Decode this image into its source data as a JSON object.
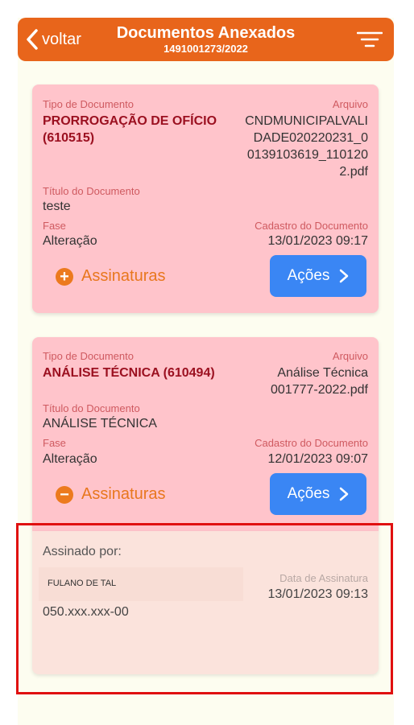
{
  "header": {
    "back_label": "voltar",
    "title": "Documentos Anexados",
    "subtitle": "1491001273/2022"
  },
  "cards": [
    {
      "tipo_label": "Tipo de Documento",
      "tipo_value_lines": [
        "PRORROGAÇÃO DE OFÍCIO",
        "(610515)"
      ],
      "arquivo_label": "Arquivo",
      "arquivo_value_lines": [
        "CNDMUNICIPALVALI",
        "DADE020220231_0",
        "0139103619_110120",
        "2.pdf"
      ],
      "titulo_label": "Título do Documento",
      "titulo_value": "teste",
      "fase_label": "Fase",
      "fase_value": "Alteração",
      "cadastro_label": "Cadastro do Documento",
      "cadastro_value": "13/01/2023 09:17",
      "assinaturas_label": "Assinaturas",
      "assinaturas_symbol": "+",
      "acoes_label": "Ações"
    },
    {
      "tipo_label": "Tipo de Documento",
      "tipo_value_lines": [
        "ANÁLISE TÉCNICA (610494)"
      ],
      "arquivo_label": "Arquivo",
      "arquivo_value_lines": [
        "Análise Técnica",
        "001777-2022.pdf"
      ],
      "titulo_label": "Título do Documento",
      "titulo_value": "ANÁLISE TÉCNICA",
      "fase_label": "Fase",
      "fase_value": "Alteração",
      "cadastro_label": "Cadastro do Documento",
      "cadastro_value": "12/01/2023 09:07",
      "assinaturas_label": "Assinaturas",
      "assinaturas_symbol": "−",
      "acoes_label": "Ações"
    }
  ],
  "signatures": {
    "heading": "Assinado por:",
    "signer_name": "FULANO DE TAL",
    "signer_doc": "050.xxx.xxx-00",
    "date_label": "Data de Assinatura",
    "date_value": "13/01/2023 09:13"
  },
  "colors": {
    "header_bg": "#e8651b",
    "card_bg": "#ffc4cb",
    "accent_orange": "#ec7a1e",
    "button_blue": "#3a86f4",
    "highlight_red": "#e01010"
  },
  "icons": [
    "chevron-left-icon",
    "filter-icon",
    "plus-circle-icon",
    "minus-circle-icon",
    "chevron-right-icon"
  ]
}
